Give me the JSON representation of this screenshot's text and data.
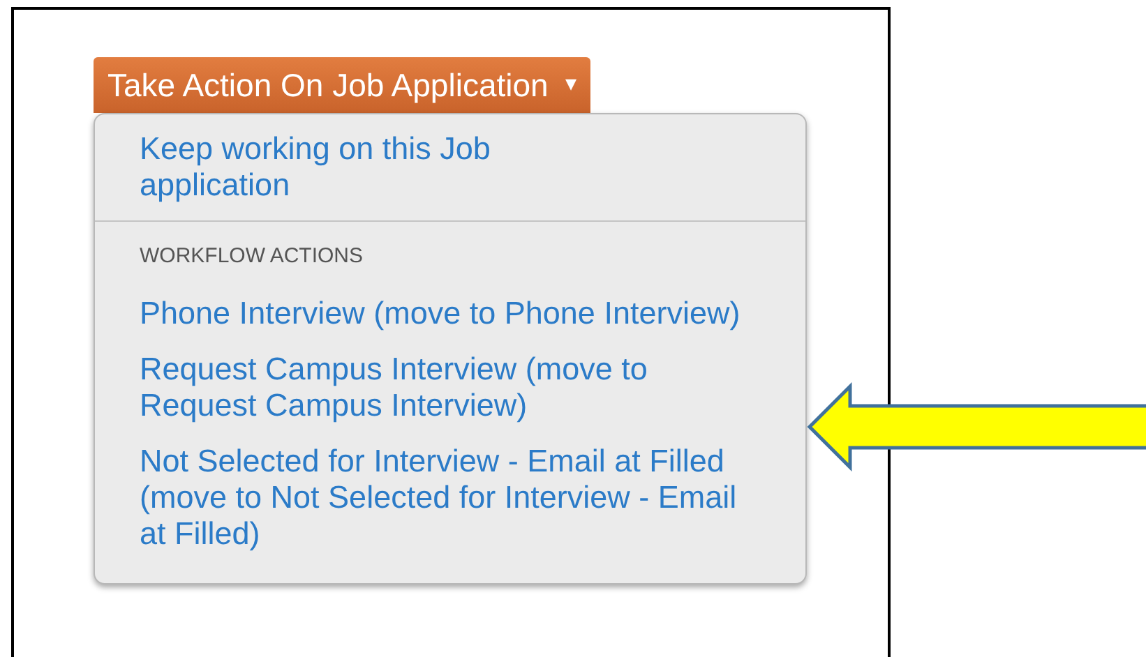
{
  "action_button": {
    "label": "Take Action On Job Application",
    "caret": "▾",
    "expanded": true
  },
  "menu": {
    "items": [
      {
        "kind": "link",
        "label": "Keep working on this Job application"
      },
      {
        "kind": "divider"
      },
      {
        "kind": "header",
        "label": "WORKFLOW ACTIONS"
      },
      {
        "kind": "link",
        "label": "Phone Interview (move to Phone Interview)"
      },
      {
        "kind": "link",
        "label": "Request Campus Interview (move to Request Campus Interview)"
      },
      {
        "kind": "link",
        "label": "Not Selected for Interview - Email at Filled (move to Not Selected for Interview - Email at Filled)"
      }
    ]
  }
}
